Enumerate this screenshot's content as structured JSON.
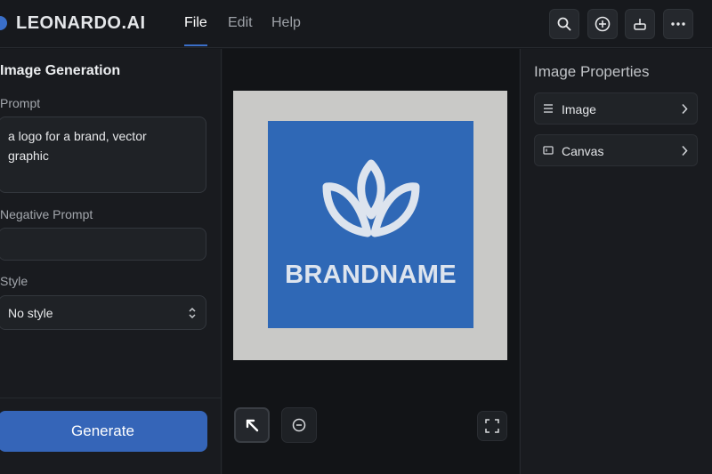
{
  "app": {
    "brand": "LEONARDO.AI",
    "menu": [
      "File",
      "Edit",
      "Help"
    ],
    "active_menu": "File",
    "toolbar_icons": [
      "search-icon",
      "add-circle-icon",
      "upload-icon",
      "more-icon"
    ]
  },
  "left_panel": {
    "title": "Image Generation",
    "prompt_label": "Prompt",
    "prompt_value": "a logo for a brand, vector graphic",
    "negative_label": "Negative Prompt",
    "negative_value": "",
    "style_label": "Style",
    "style_value": "No style",
    "generate_label": "Generate"
  },
  "canvas": {
    "logo_text": "BRANDNAME",
    "tools": [
      "select-arrow-icon",
      "zoom-out-icon",
      "fullscreen-icon"
    ]
  },
  "right_panel": {
    "title": "Image Properties",
    "items": [
      {
        "label": "Image",
        "icon": "list-icon"
      },
      {
        "label": "Canvas",
        "icon": "canvas-icon"
      }
    ]
  },
  "colors": {
    "accent": "#3565b8",
    "logo_bg": "#2f68b6",
    "artboard": "#c9c9c7",
    "background": "#16181c"
  }
}
